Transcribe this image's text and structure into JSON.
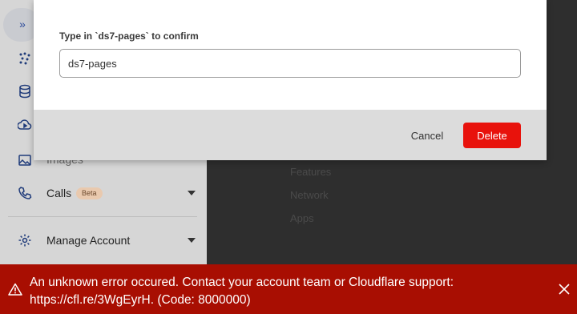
{
  "sidebar": {
    "items": [
      {
        "label": "Images"
      },
      {
        "label": "Calls",
        "badge": "Beta"
      },
      {
        "label": "Manage Account"
      }
    ]
  },
  "main": {
    "links": [
      "Features",
      "Network",
      "Apps"
    ]
  },
  "modal": {
    "confirm_label": "Type in `ds7-pages` to confirm",
    "input_value": "ds7-pages",
    "cancel_label": "Cancel",
    "delete_label": "Delete"
  },
  "error_banner": {
    "line1": "An unknown error occured. Contact your account team or Cloudflare support:",
    "line2": "https://cfl.re/3WgEyrH. (Code: 8000000)"
  },
  "colors": {
    "delete_button": "#e8120c",
    "error_banner": "#a80e02"
  }
}
